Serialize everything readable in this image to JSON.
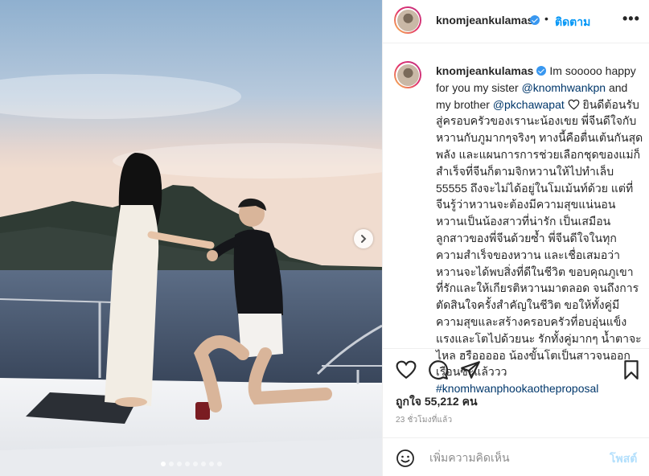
{
  "post": {
    "author": {
      "username": "knomjeankulamas",
      "verified_icon": "verified-badge-icon"
    },
    "header": {
      "bullet": "•",
      "follow_label": "ติดตาม",
      "more_label": "•••"
    },
    "photo": {
      "slides_count": 8,
      "active_slide": 1,
      "next_icon": "chevron-right-icon"
    },
    "caption": {
      "text_1": "Im sooooo happy for you my sister ",
      "mention_1": "@knomhwankpn",
      "text_2": " and my brother ",
      "mention_2": "@pkchawapat",
      "heart_icon": "heart-outline-icon",
      "text_3": " ยินดีต้อนรับสู่ครอบครัวของเรานะน้องเขย พี่จีนดีใจกับหวานกับภูมากๆจริงๆ ทางนี้คือตื่นเต้นกันสุดพลัง และแผนการการช่วยเลือกชุดของแม่ก็สำเร็จที่จีนก็ตามจิกหวานให้ไปทำเล็บ 55555 ถึงจะไม่ได้อยู่ในโมเม้นท์ด้วย แต่ที่จีนรู้ว่าหวานจะต้องมีความสุขแน่นอน หวานเป็นน้องสาวที่น่ารัก เป็นเสมือนลูกสาวของพี่จีนด้วยซ้ำ พี่จีนดีใจในทุกความสำเร็จของหวาน และเชื่อเสมอว่าหวานจะได้พบสิ่งที่ดีในชีวิต ขอบคุณภูเขาที่รักและให้เกียรติหวานมาตลอด จนถึงการตัดสินใจครั้งสำคัญในชีวิต ขอให้ทั้งคู่มีความสุขและสร้างครอบครัวที่อบอุ่นแข็งแรงและโตไปด้วยนะ รักทั้งคู่มากๆ น้ำตาจะไหล ฮรือออออ น้องขั้นโตเป็นสาวจนออกเรือนซะแล้ววว",
      "hashtag": "#knomhwanphookaotheproposal"
    },
    "actions": {
      "like_icon": "heart-icon",
      "comment_icon": "comment-icon",
      "share_icon": "paper-plane-icon",
      "save_icon": "bookmark-icon"
    },
    "likes_text": "ถูกใจ 55,212 คน",
    "time_text": "23 ชั่วโมงที่แล้ว",
    "add_comment": {
      "emoji_icon": "smiley-icon",
      "placeholder": "เพิ่มความคิดเห็น",
      "post_label": "โพสต์"
    },
    "colors": {
      "link": "#0095f6",
      "mention": "#00376b",
      "verified": "#3897f0",
      "post_disabled": "#b2dffc",
      "muted": "#8e8e8e"
    }
  }
}
